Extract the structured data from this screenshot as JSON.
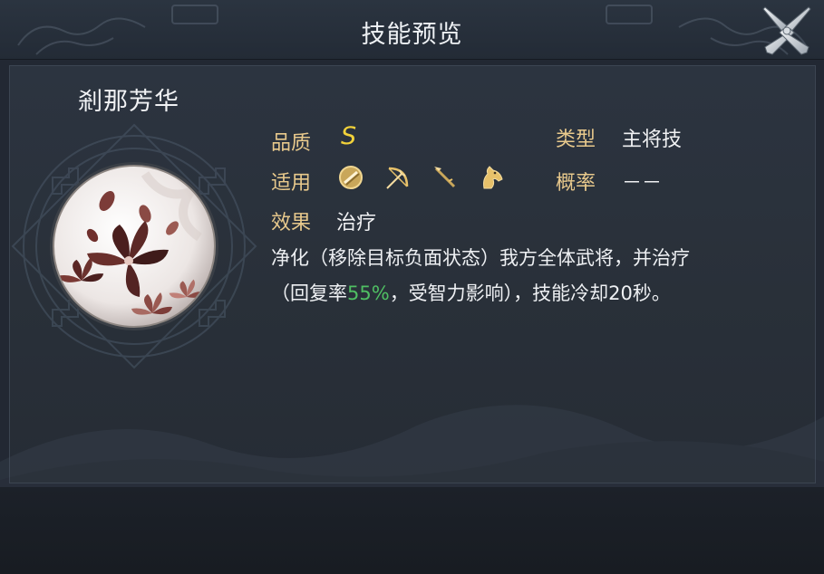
{
  "dialog": {
    "title": "技能预览"
  },
  "skill": {
    "name": "剎那芳华",
    "quality_label": "品质",
    "quality_value": "S",
    "apply_label": "适用",
    "apply_icons": [
      "shield-icon",
      "bow-icon",
      "spear-icon",
      "horse-icon"
    ],
    "type_label": "类型",
    "type_value": "主将技",
    "chance_label": "概率",
    "chance_value": "－－",
    "effect_label": "效果",
    "effect_value": "治疗",
    "description": {
      "line1": "净化（移除目标负面状态）我方全体武将，并治疗",
      "line2_prefix": "（回复率",
      "line2_highlight": "55%",
      "line2_suffix": "，受智力影响），技能冷却20秒。"
    }
  },
  "colors": {
    "label": "#e8c98c",
    "quality": "#f2d23a",
    "highlight": "#4fbf63",
    "icon_gold": "#e7c16a"
  }
}
